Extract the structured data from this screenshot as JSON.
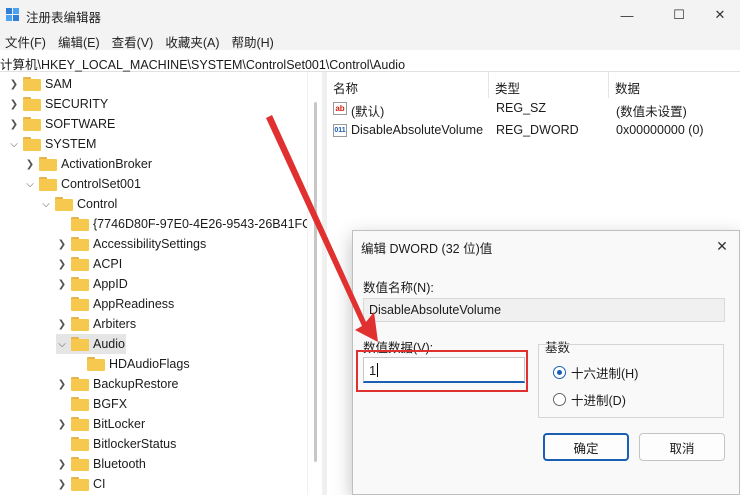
{
  "window": {
    "title": "注册表编辑器",
    "controls": {
      "minimize": "—",
      "maximize": "☐",
      "close": "✕"
    }
  },
  "menu": [
    "文件(F)",
    "编辑(E)",
    "查看(V)",
    "收藏夹(A)",
    "帮助(H)"
  ],
  "address": "计算机\\HKEY_LOCAL_MACHINE\\SYSTEM\\ControlSet001\\Control\\Audio",
  "tree": [
    {
      "label": "SAM",
      "expanded": false
    },
    {
      "label": "SECURITY",
      "expanded": false
    },
    {
      "label": "SOFTWARE",
      "expanded": false
    },
    {
      "label": "SYSTEM",
      "expanded": true
    },
    {
      "label": "ActivationBroker",
      "expanded": false
    },
    {
      "label": "ControlSet001",
      "expanded": true
    },
    {
      "label": "Control",
      "expanded": true
    },
    {
      "label": "{7746D80F-97E0-4E26-9543-26B41FC",
      "expanded": false
    },
    {
      "label": "AccessibilitySettings",
      "expanded": false
    },
    {
      "label": "ACPI",
      "expanded": false
    },
    {
      "label": "AppID",
      "expanded": false
    },
    {
      "label": "AppReadiness",
      "expanded": false
    },
    {
      "label": "Arbiters",
      "expanded": false
    },
    {
      "label": "Audio",
      "expanded": true,
      "selected": true
    },
    {
      "label": "HDAudioFlags",
      "expanded": false
    },
    {
      "label": "BackupRestore",
      "expanded": false
    },
    {
      "label": "BGFX",
      "expanded": false
    },
    {
      "label": "BitLocker",
      "expanded": false
    },
    {
      "label": "BitlockerStatus",
      "expanded": false
    },
    {
      "label": "Bluetooth",
      "expanded": false
    },
    {
      "label": "CI",
      "expanded": false
    }
  ],
  "list": {
    "headers": [
      "名称",
      "类型",
      "数据"
    ],
    "rows": [
      {
        "icon": "ab",
        "name": "(默认)",
        "type": "REG_SZ",
        "data": "(数值未设置)"
      },
      {
        "icon": "011",
        "name": "DisableAbsoluteVolume",
        "type": "REG_DWORD",
        "data": "0x00000000 (0)"
      }
    ]
  },
  "dialog": {
    "title": "编辑 DWORD (32 位)值",
    "close": "✕",
    "name_label": "数值名称(N):",
    "name_value": "DisableAbsoluteVolume",
    "data_label": "数值数据(V):",
    "data_value": "1",
    "base_label": "基数",
    "radio_hex": "十六进制(H)",
    "radio_dec": "十进制(D)",
    "ok": "确定",
    "cancel": "取消"
  },
  "colors": {
    "accent": "#1a5fb4",
    "annotation": "#e03030",
    "folder": "#f6c94e"
  }
}
